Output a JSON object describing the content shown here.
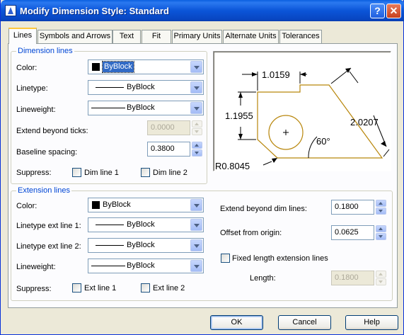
{
  "window": {
    "title": "Modify Dimension Style: Standard",
    "help_label": "?",
    "close_label": "✕"
  },
  "tabs": [
    {
      "label": "Lines"
    },
    {
      "label": "Symbols and Arrows"
    },
    {
      "label": "Text"
    },
    {
      "label": "Fit"
    },
    {
      "label": "Primary Units"
    },
    {
      "label": "Alternate Units"
    },
    {
      "label": "Tolerances"
    }
  ],
  "dimension_lines": {
    "title": "Dimension lines",
    "color_label": "Color:",
    "color_value": "ByBlock",
    "linetype_label": "Linetype:",
    "linetype_value": "ByBlock",
    "lineweight_label": "Lineweight:",
    "lineweight_value": "ByBlock",
    "extend_label": "Extend beyond ticks:",
    "extend_value": "0.0000",
    "baseline_label": "Baseline spacing:",
    "baseline_value": "0.3800",
    "suppress_label": "Suppress:",
    "dim1_label": "Dim line 1",
    "dim2_label": "Dim line 2"
  },
  "extension_lines": {
    "title": "Extension lines",
    "color_label": "Color:",
    "color_value": "ByBlock",
    "lt1_label": "Linetype ext line 1:",
    "lt1_value": "ByBlock",
    "lt2_label": "Linetype ext line 2:",
    "lt2_value": "ByBlock",
    "lineweight_label": "Lineweight:",
    "lineweight_value": "ByBlock",
    "suppress_label": "Suppress:",
    "ext1_label": "Ext line 1",
    "ext2_label": "Ext line 2",
    "extend_label": "Extend beyond dim lines:",
    "extend_value": "0.1800",
    "offset_label": "Offset from origin:",
    "offset_value": "0.0625",
    "fixed_label": "Fixed length extension lines",
    "length_label": "Length:",
    "length_value": "0.1800"
  },
  "preview": {
    "dim_top": "1.0159",
    "dim_left": "1.1955",
    "dim_right": "2.0207",
    "angle": "60°",
    "radius": "R0.8045",
    "outline_color": "#b8860b"
  },
  "buttons": {
    "ok": "OK",
    "cancel": "Cancel",
    "help": "Help"
  },
  "colors": {
    "accent": "#0046d5",
    "title_bar": "#0a5fe0",
    "selection": "#316ac5"
  }
}
